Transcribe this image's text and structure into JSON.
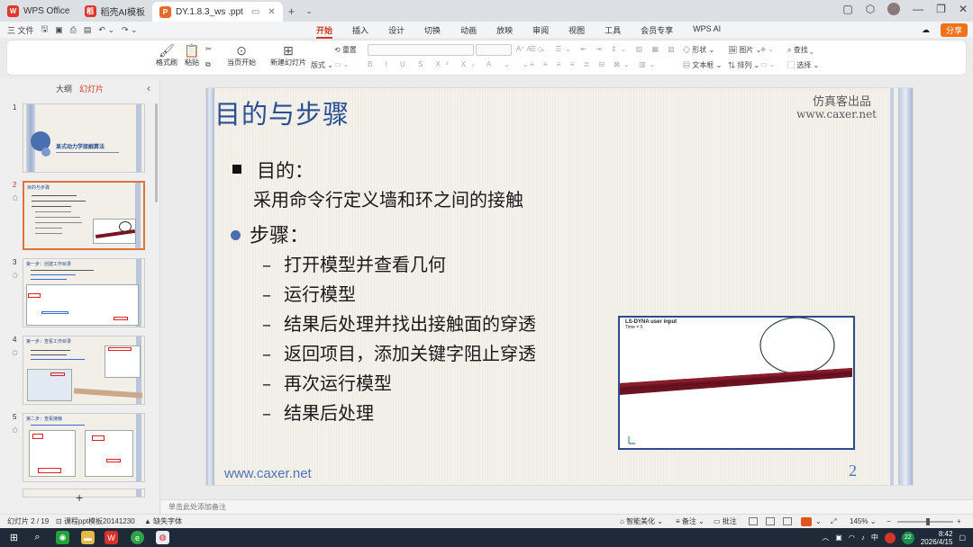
{
  "tabs": [
    {
      "label": "WPS Office",
      "icon": "W",
      "color": "#e2352b"
    },
    {
      "label": "稻壳AI模板",
      "icon": "稻",
      "color": "#e2352b"
    },
    {
      "label": "DY.1.8.3_ws .ppt",
      "icon": "P",
      "color": "#e8692c"
    }
  ],
  "menu": {
    "file": "三 文件",
    "tabs": [
      "开始",
      "插入",
      "设计",
      "切换",
      "动画",
      "放映",
      "审阅",
      "视图",
      "工具",
      "会员专享",
      "WPS AI"
    ],
    "active_tab": "开始",
    "share": "分享"
  },
  "ribbon": {
    "format_painter": "格式刷",
    "paste": "粘贴",
    "from_current": "当页开始",
    "new_slide": "新建幻灯片",
    "layout": "版式",
    "reset": "重置",
    "shape": "形状",
    "image": "图片",
    "textbox": "文本框",
    "arrange": "排列",
    "find": "查找",
    "select": "选择"
  },
  "panel": {
    "outline_tab": "大纲",
    "slides_tab": "幻灯片",
    "thumbnails": [
      {
        "num": "1",
        "text": "显式动力学接触算法"
      },
      {
        "num": "2",
        "text": "目的与步骤"
      },
      {
        "num": "3",
        "text": "第一步：创建工作目录"
      },
      {
        "num": "4",
        "text": "第一步：查看工作目录"
      },
      {
        "num": "5",
        "text": "第二步：查看接触"
      }
    ],
    "add": "+"
  },
  "slide": {
    "title": "目的与步骤",
    "brand_line1": "仿真客出品",
    "brand_line2": "www.caxer.net",
    "purpose_heading": "目的：",
    "purpose_text": "采用命令行定义墙和环之间的接触",
    "steps_heading": "步骤：",
    "steps": [
      "打开模型并查看几何",
      "运行模型",
      "结果后处理并找出接触面的穿透",
      "返回项目，添加关键字阻止穿透",
      "再次运行模型",
      "结果后处理"
    ],
    "dash": "–",
    "footer": "www.caxer.net",
    "page_number": "2",
    "shot_title": "LS-DYNA user input",
    "shot_time": "Time =       0"
  },
  "notes_placeholder": "单击此处添加备注",
  "status": {
    "slide_info": "幻灯片 2 / 19",
    "template": "课程ppt模板20141230",
    "missing_font": "缺失字体",
    "beautify": "智能美化",
    "notes": "备注",
    "comments": "批注",
    "zoom": "145%"
  },
  "taskbar": {
    "time": "8:42",
    "date": "2026/4/15",
    "ime": "中",
    "badge": "22"
  }
}
